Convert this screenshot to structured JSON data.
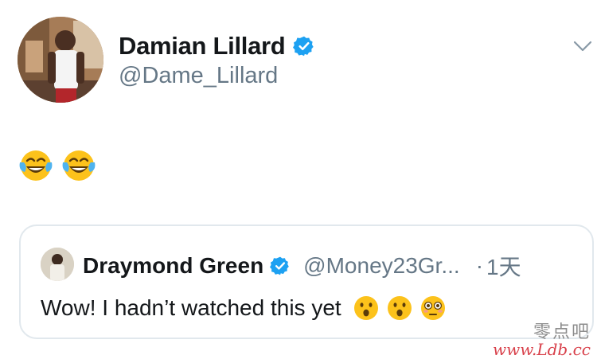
{
  "tweet": {
    "author": {
      "display_name": "Damian Lillard",
      "handle": "@Dame_Lillard",
      "verified_icon": "verified-badge-icon",
      "avatar": "profile-photo"
    },
    "menu_icon": "chevron-down-icon",
    "body_emoji": [
      "face-with-tears-of-joy",
      "face-with-tears-of-joy"
    ]
  },
  "quoted_tweet": {
    "author": {
      "display_name": "Draymond Green",
      "handle": "@Money23Gr...",
      "verified_icon": "verified-badge-icon"
    },
    "separator": "·",
    "timestamp": "1天",
    "text": "Wow! I hadn’t watched this yet",
    "emoji": [
      "face-with-open-mouth",
      "face-with-open-mouth",
      "flushed-face"
    ]
  },
  "watermark": {
    "chinese": "零点吧",
    "url": "www.Ldb.cc"
  },
  "colors": {
    "verified_blue": "#1da1f2",
    "name_text": "#14171a",
    "secondary_text": "#657786",
    "card_border": "#e1e8ed",
    "watermark_red": "#d21f2b"
  }
}
